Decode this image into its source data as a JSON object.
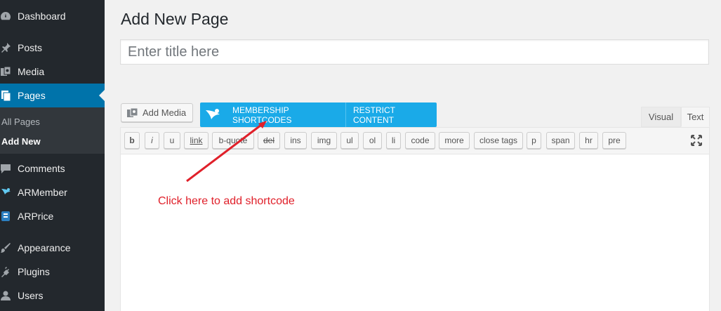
{
  "sidebar": {
    "items": [
      {
        "label": "Dashboard",
        "icon": "dashboard-icon"
      },
      {
        "label": "Posts",
        "icon": "pin-icon"
      },
      {
        "label": "Media",
        "icon": "media-icon"
      },
      {
        "label": "Pages",
        "icon": "pages-icon"
      },
      {
        "label": "Comments",
        "icon": "comment-icon"
      },
      {
        "label": "ARMember",
        "icon": "armember-icon"
      },
      {
        "label": "ARPrice",
        "icon": "arprice-icon"
      },
      {
        "label": "Appearance",
        "icon": "brush-icon"
      },
      {
        "label": "Plugins",
        "icon": "plugin-icon"
      },
      {
        "label": "Users",
        "icon": "user-icon"
      }
    ],
    "submenu": {
      "all_pages": "All Pages",
      "add_new": "Add New"
    },
    "active_color": "#0073aa"
  },
  "main": {
    "title": "Add New Page",
    "title_placeholder": "Enter title here",
    "add_media_label": "Add Media",
    "membership_shortcodes_label": "MEMBERSHIP SHORTCODES",
    "restrict_content_label": "RESTRICT CONTENT",
    "tabs": {
      "visual": "Visual",
      "text": "Text"
    },
    "quicktags": [
      "b",
      "i",
      "u",
      "link",
      "b-quote",
      "del",
      "ins",
      "img",
      "ul",
      "ol",
      "li",
      "code",
      "more",
      "close tags",
      "p",
      "span",
      "hr",
      "pre"
    ],
    "annotation": "Click here to add shortcode",
    "annotation_color": "#e0202a",
    "membership_bar_color": "#1aaae8"
  }
}
